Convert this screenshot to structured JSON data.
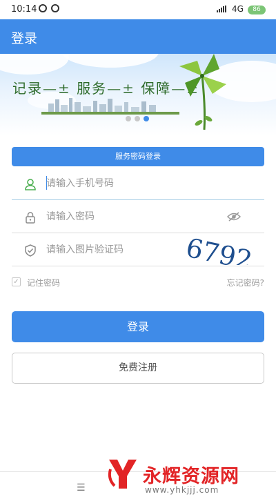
{
  "status_bar": {
    "time": "10:14",
    "network": "4G",
    "battery": "86"
  },
  "app_bar": {
    "title": "登录"
  },
  "banner": {
    "slogan": "记录—± 服务—± 保障—±",
    "slide_count": 3,
    "active_slide": 3
  },
  "login_mode": {
    "label": "服务密码登录"
  },
  "form": {
    "phone_placeholder": "请输入手机号码",
    "password_placeholder": "请输入密码",
    "captcha_placeholder": "请输入图片验证码",
    "captcha_image_text": "6792"
  },
  "remember": {
    "label": "记住密码",
    "checked": true,
    "forgot_label": "忘记密码?"
  },
  "buttons": {
    "login": "登录",
    "register": "免费注册"
  },
  "watermark": {
    "brand": "永辉资源网",
    "url": "www.yhkjjj.com"
  },
  "colors": {
    "primary": "#3f8be8",
    "watermark_red": "#e22426"
  },
  "icons": {
    "phone_field": "user-icon",
    "password_field": "lock-icon",
    "captcha_field": "shield-check-icon",
    "password_toggle": "eye-icon",
    "nav_menu": "menu-icon"
  }
}
